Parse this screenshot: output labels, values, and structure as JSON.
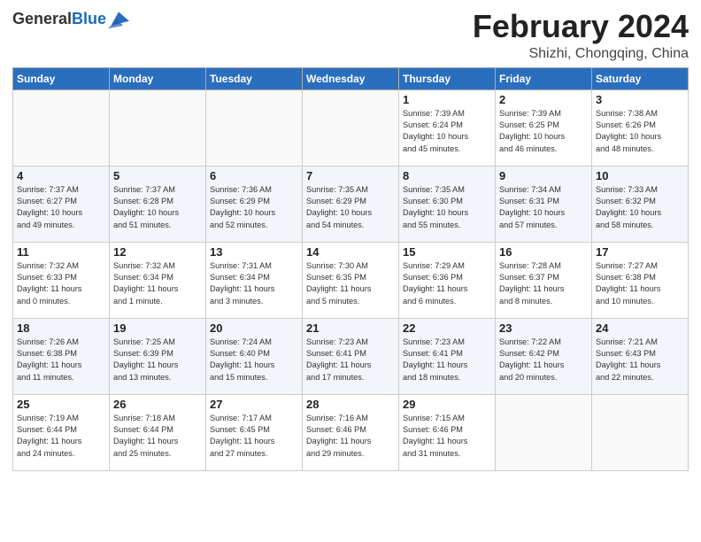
{
  "header": {
    "logo_general": "General",
    "logo_blue": "Blue",
    "title": "February 2024",
    "location": "Shizhi, Chongqing, China"
  },
  "weekdays": [
    "Sunday",
    "Monday",
    "Tuesday",
    "Wednesday",
    "Thursday",
    "Friday",
    "Saturday"
  ],
  "weeks": [
    [
      {
        "day": "",
        "info": ""
      },
      {
        "day": "",
        "info": ""
      },
      {
        "day": "",
        "info": ""
      },
      {
        "day": "",
        "info": ""
      },
      {
        "day": "1",
        "info": "Sunrise: 7:39 AM\nSunset: 6:24 PM\nDaylight: 10 hours\nand 45 minutes."
      },
      {
        "day": "2",
        "info": "Sunrise: 7:39 AM\nSunset: 6:25 PM\nDaylight: 10 hours\nand 46 minutes."
      },
      {
        "day": "3",
        "info": "Sunrise: 7:38 AM\nSunset: 6:26 PM\nDaylight: 10 hours\nand 48 minutes."
      }
    ],
    [
      {
        "day": "4",
        "info": "Sunrise: 7:37 AM\nSunset: 6:27 PM\nDaylight: 10 hours\nand 49 minutes."
      },
      {
        "day": "5",
        "info": "Sunrise: 7:37 AM\nSunset: 6:28 PM\nDaylight: 10 hours\nand 51 minutes."
      },
      {
        "day": "6",
        "info": "Sunrise: 7:36 AM\nSunset: 6:29 PM\nDaylight: 10 hours\nand 52 minutes."
      },
      {
        "day": "7",
        "info": "Sunrise: 7:35 AM\nSunset: 6:29 PM\nDaylight: 10 hours\nand 54 minutes."
      },
      {
        "day": "8",
        "info": "Sunrise: 7:35 AM\nSunset: 6:30 PM\nDaylight: 10 hours\nand 55 minutes."
      },
      {
        "day": "9",
        "info": "Sunrise: 7:34 AM\nSunset: 6:31 PM\nDaylight: 10 hours\nand 57 minutes."
      },
      {
        "day": "10",
        "info": "Sunrise: 7:33 AM\nSunset: 6:32 PM\nDaylight: 10 hours\nand 58 minutes."
      }
    ],
    [
      {
        "day": "11",
        "info": "Sunrise: 7:32 AM\nSunset: 6:33 PM\nDaylight: 11 hours\nand 0 minutes."
      },
      {
        "day": "12",
        "info": "Sunrise: 7:32 AM\nSunset: 6:34 PM\nDaylight: 11 hours\nand 1 minute."
      },
      {
        "day": "13",
        "info": "Sunrise: 7:31 AM\nSunset: 6:34 PM\nDaylight: 11 hours\nand 3 minutes."
      },
      {
        "day": "14",
        "info": "Sunrise: 7:30 AM\nSunset: 6:35 PM\nDaylight: 11 hours\nand 5 minutes."
      },
      {
        "day": "15",
        "info": "Sunrise: 7:29 AM\nSunset: 6:36 PM\nDaylight: 11 hours\nand 6 minutes."
      },
      {
        "day": "16",
        "info": "Sunrise: 7:28 AM\nSunset: 6:37 PM\nDaylight: 11 hours\nand 8 minutes."
      },
      {
        "day": "17",
        "info": "Sunrise: 7:27 AM\nSunset: 6:38 PM\nDaylight: 11 hours\nand 10 minutes."
      }
    ],
    [
      {
        "day": "18",
        "info": "Sunrise: 7:26 AM\nSunset: 6:38 PM\nDaylight: 11 hours\nand 11 minutes."
      },
      {
        "day": "19",
        "info": "Sunrise: 7:25 AM\nSunset: 6:39 PM\nDaylight: 11 hours\nand 13 minutes."
      },
      {
        "day": "20",
        "info": "Sunrise: 7:24 AM\nSunset: 6:40 PM\nDaylight: 11 hours\nand 15 minutes."
      },
      {
        "day": "21",
        "info": "Sunrise: 7:23 AM\nSunset: 6:41 PM\nDaylight: 11 hours\nand 17 minutes."
      },
      {
        "day": "22",
        "info": "Sunrise: 7:23 AM\nSunset: 6:41 PM\nDaylight: 11 hours\nand 18 minutes."
      },
      {
        "day": "23",
        "info": "Sunrise: 7:22 AM\nSunset: 6:42 PM\nDaylight: 11 hours\nand 20 minutes."
      },
      {
        "day": "24",
        "info": "Sunrise: 7:21 AM\nSunset: 6:43 PM\nDaylight: 11 hours\nand 22 minutes."
      }
    ],
    [
      {
        "day": "25",
        "info": "Sunrise: 7:19 AM\nSunset: 6:44 PM\nDaylight: 11 hours\nand 24 minutes."
      },
      {
        "day": "26",
        "info": "Sunrise: 7:18 AM\nSunset: 6:44 PM\nDaylight: 11 hours\nand 25 minutes."
      },
      {
        "day": "27",
        "info": "Sunrise: 7:17 AM\nSunset: 6:45 PM\nDaylight: 11 hours\nand 27 minutes."
      },
      {
        "day": "28",
        "info": "Sunrise: 7:16 AM\nSunset: 6:46 PM\nDaylight: 11 hours\nand 29 minutes."
      },
      {
        "day": "29",
        "info": "Sunrise: 7:15 AM\nSunset: 6:46 PM\nDaylight: 11 hours\nand 31 minutes."
      },
      {
        "day": "",
        "info": ""
      },
      {
        "day": "",
        "info": ""
      }
    ]
  ]
}
